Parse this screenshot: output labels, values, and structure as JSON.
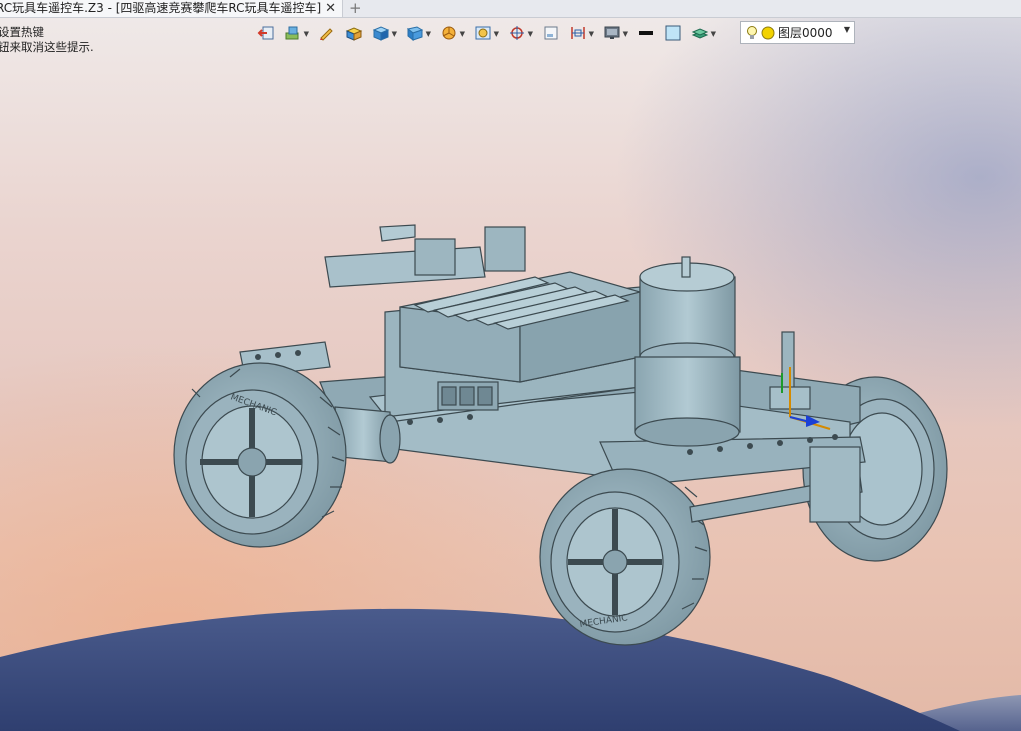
{
  "window": {
    "tab_title": "RC玩具车遥控车.Z3 - [四驱高速竞赛攀爬车RC玩具车遥控车]",
    "tab_close": "✕",
    "tab_add": "+"
  },
  "hints": {
    "line1": "设置热键",
    "line2": "钮来取消这些提示."
  },
  "toolbar": {
    "buttons": [
      {
        "icon": "exit-icon"
      },
      {
        "icon": "assembly-icon"
      },
      {
        "icon": "pencil-icon"
      },
      {
        "icon": "shaded-box-icon"
      },
      {
        "icon": "blue-cube-icon"
      },
      {
        "icon": "view-cube-icon"
      },
      {
        "icon": "pie-section-icon"
      },
      {
        "icon": "frame-icon"
      },
      {
        "icon": "crosshair-icon"
      },
      {
        "icon": "sheet-icon"
      },
      {
        "icon": "dimension-icon"
      },
      {
        "icon": "display-icon"
      },
      {
        "icon": "line-weight-icon"
      },
      {
        "icon": "fill-color-icon"
      },
      {
        "icon": "layer-stack-icon"
      }
    ],
    "layer_select": {
      "value": "图层0000",
      "bulb_color": "#f2d200",
      "dot_color": "#f2d200"
    }
  },
  "model": {
    "name": "四驱高速竞赛攀爬车RC玩具车遥控车",
    "body_color": "#9fb9c4",
    "edge_color": "#3c4a50",
    "tire_text": "MECHANIC"
  },
  "colors": {
    "sky_top": "#efe9e8",
    "hill": "#3f5284"
  }
}
